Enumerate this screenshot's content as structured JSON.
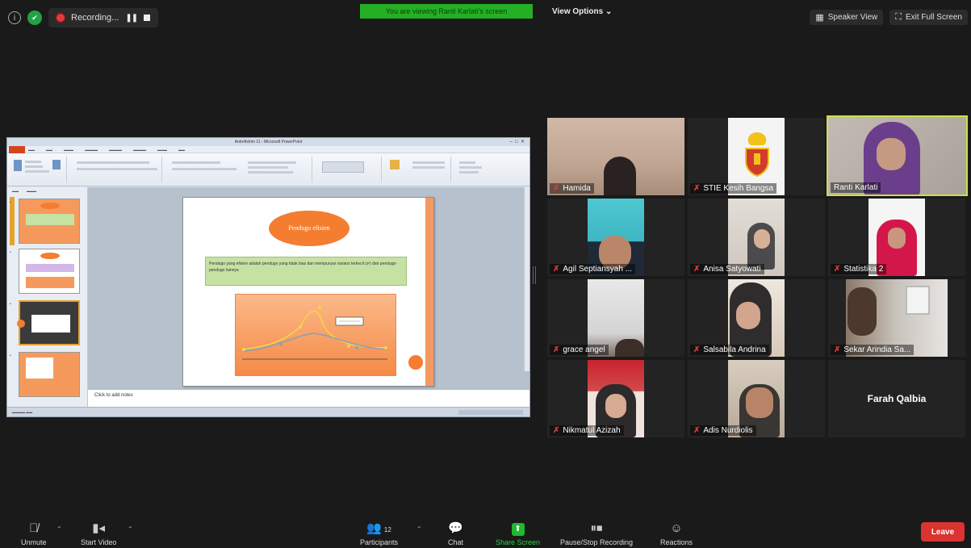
{
  "top_bar": {
    "recording_label": "Recording...",
    "viewing_banner": "You are viewing Ranti Karlati's screen",
    "view_options": "View Options ⌄",
    "speaker_view": "Speaker View",
    "exit_full_screen": "Exit Full Screen"
  },
  "presentation": {
    "window_title": "Antrefixtrim 11 - Microsoft PowerPoint",
    "slide_title": "Pendugo efisien",
    "slide_definition": "Pendugo yang efisien adalah pendugo yang tidak bias dan mempunyai varians terkecil (s²) dari pendugo-pendugo lainnya",
    "notes_placeholder": "Click to add notes"
  },
  "participants": [
    {
      "name": "Hamida",
      "tile": "hamida"
    },
    {
      "name": "STIE Kesih Bangsa",
      "tile": "stie"
    },
    {
      "name": "Ranti Karlati",
      "tile": "ranti"
    },
    {
      "name": "Agil Septiansyah ...",
      "tile": "agil"
    },
    {
      "name": "Anisa Satyowati",
      "tile": "anisa"
    },
    {
      "name": "Statistika 2",
      "tile": "statistika"
    },
    {
      "name": "grace angel",
      "tile": "grace"
    },
    {
      "name": "Salsabila Andrina",
      "tile": "salsabila"
    },
    {
      "name": "Sekar Arindia Sa...",
      "tile": "sekar"
    },
    {
      "name": "Nikmatul Azizah",
      "tile": "nikmatul"
    },
    {
      "name": "Adis Nurdiolis",
      "tile": "adis"
    },
    {
      "name": "Farah Qalbia",
      "tile": "farah"
    }
  ],
  "toolbar": {
    "unmute": "Unmute",
    "start_video": "Start Video",
    "participants": "Participants",
    "participant_count": "12",
    "chat": "Chat",
    "share_screen": "Share Screen",
    "pause_stop_recording": "Pause/Stop Recording",
    "reactions": "Reactions",
    "leave": "Leave"
  },
  "colors": {
    "banner_green": "#24b024",
    "active_speaker_border": "#c9e04a",
    "leave_red": "#d9342f",
    "slide_orange": "#f47d30"
  }
}
